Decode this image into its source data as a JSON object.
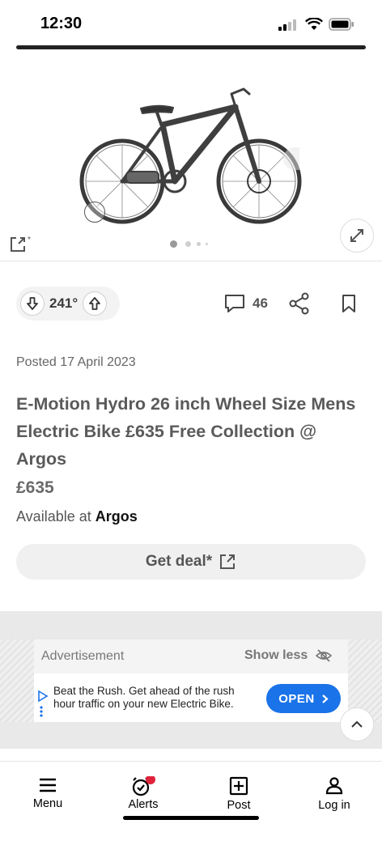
{
  "status_bar": {
    "time": "12:30"
  },
  "gallery": {
    "slide_count": 4,
    "active_slide": 1
  },
  "deal": {
    "temperature": "241°",
    "comments": "46",
    "posted": "Posted 17 April 2023",
    "title": "E-Motion Hydro 26 inch Wheel Size Mens Electric Bike £635 Free Collection @ Argos",
    "price": "£635",
    "available_prefix": "Available at",
    "merchant": "Argos",
    "cta_label": "Get deal*"
  },
  "ad": {
    "label": "Advertisement",
    "show_less": "Show less",
    "text": "Beat the Rush. Get ahead of the rush hour traffic on your new Electric Bike.",
    "open_label": "OPEN"
  },
  "nav": [
    {
      "label": "Menu",
      "icon": "menu-icon"
    },
    {
      "label": "Alerts",
      "icon": "alarm-icon"
    },
    {
      "label": "Post",
      "icon": "plus-square-icon"
    },
    {
      "label": "Log in",
      "icon": "user-icon"
    }
  ],
  "colors": {
    "accent_blue": "#1a73e8",
    "alert_dot": "#e0233b"
  }
}
